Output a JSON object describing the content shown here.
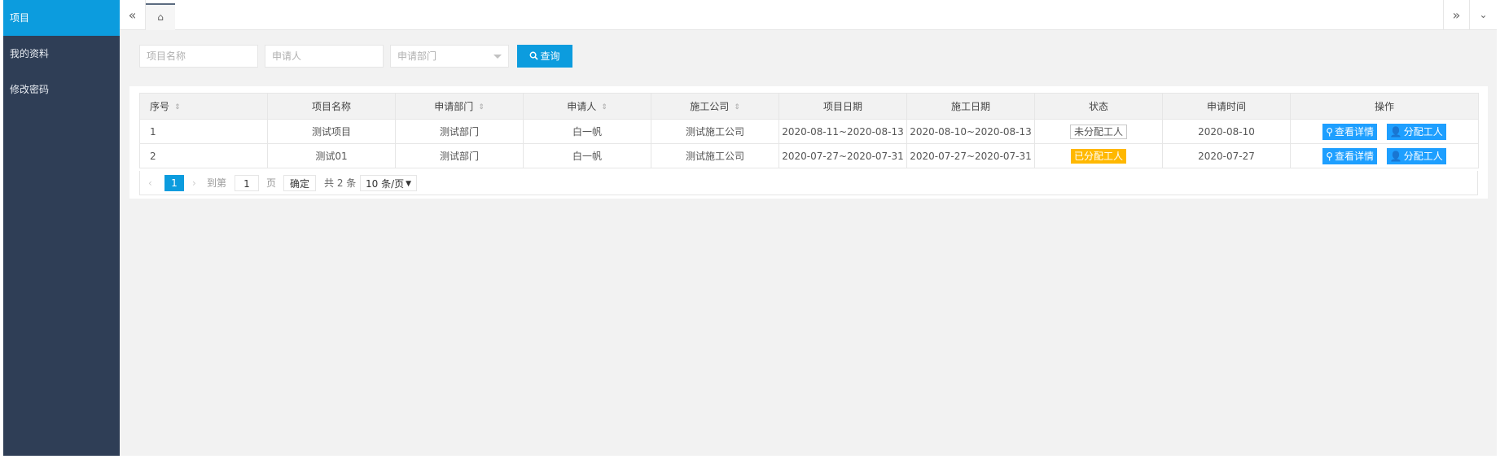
{
  "sidebar": {
    "items": [
      {
        "label": "项目",
        "active": true
      },
      {
        "label": "我的资料"
      },
      {
        "label": "修改密码"
      }
    ]
  },
  "tabbar": {
    "left_glyph": "«",
    "home_glyph": "⌂",
    "right_glyph": "»",
    "more_glyph": "⌄"
  },
  "search": {
    "project_name_placeholder": "项目名称",
    "applicant_placeholder": "申请人",
    "department_placeholder": "申请部门",
    "query_label": "查询",
    "query_icon": "search-icon"
  },
  "table": {
    "headers": [
      "序号",
      "项目名称",
      "申请部门",
      "申请人",
      "施工公司",
      "项目日期",
      "施工日期",
      "状态",
      "申请时间",
      "操作"
    ],
    "rows": [
      {
        "index": "1",
        "name": "测试项目",
        "department": "测试部门",
        "applicant": "白一帆",
        "company": "测试施工公司",
        "project_date": "2020-08-11~2020-08-13",
        "construction_date": "2020-08-10~2020-08-13",
        "status": "未分配工人",
        "apply_time": "2020-08-10",
        "op_view": "查看详情",
        "op_assign": "分配工人"
      },
      {
        "index": "2",
        "name": "测试01",
        "department": "测试部门",
        "applicant": "白一帆",
        "company": "测试施工公司",
        "project_date": "2020-07-27~2020-07-31",
        "construction_date": "2020-07-27~2020-07-31",
        "status": "已分配工人",
        "apply_time": "2020-07-27",
        "op_view": "查看详情",
        "op_assign": "分配工人"
      }
    ]
  },
  "pager": {
    "prev": "‹",
    "current": "1",
    "next": "›",
    "goto_label": "到第",
    "goto_value": "1",
    "page_unit": "页",
    "confirm": "确定",
    "total": "共 2 条",
    "page_size": "10 条/页"
  },
  "colors": {
    "sidebar_bg": "#2f3e56",
    "accent": "#0c9cde",
    "op_button": "#1e9fff",
    "badge_assigned": "#ffb800"
  }
}
